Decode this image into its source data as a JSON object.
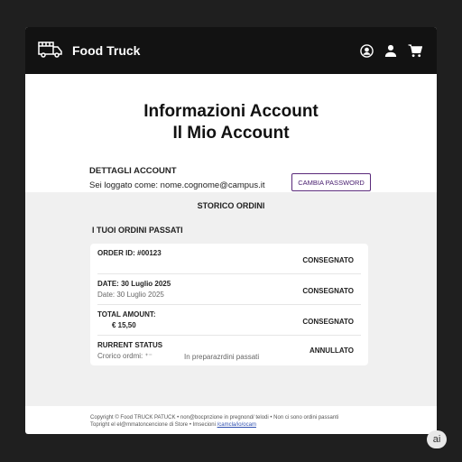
{
  "header": {
    "brand": "Food Truck",
    "icons": [
      "food-truck-icon",
      "account-circle-icon",
      "user-icon",
      "cart-icon"
    ]
  },
  "page": {
    "title1": "Informazioni Account",
    "title2": "Il Mio Account"
  },
  "details": {
    "label": "DETTAGLI ACCOUNT",
    "logged": "Sei loggato come: nome.cognome@campus.it",
    "button": "CAMBIA PASSWORD"
  },
  "history": {
    "title": "STORICO ORDINI",
    "subtitle": "I TUOI ORDINI PASSATI",
    "rows": [
      {
        "l1": "ORDER ID: #00123",
        "l2": "",
        "mid": "",
        "status": "CONSEGNATO"
      },
      {
        "l1": "DATE: 30 Luglio 2025",
        "l2": "Date: 30 Luglio 2025",
        "mid": "",
        "status": "CONSEGNATO"
      },
      {
        "l1": "TOTAL AMOUNT:",
        "l2": "€ 15,50",
        "mid": "",
        "status": "CONSEGNATO"
      },
      {
        "l1": "RURRENT STATUS",
        "l2": "Crorico ordmi: ⁺⁻",
        "mid": "In preparazrdini passati",
        "status": "ANNULLATO"
      }
    ]
  },
  "footer": {
    "line1": "Copyright © Food TRUCK PATUCK  •  non@bocpnzione in pregnond/ telodi  •  Non ci sono ordini passanti",
    "line2": "Topright el el@mmatoncencione di Store  •  Imsecioni ",
    "link": "/camcla/io/ocam"
  },
  "badge": "ai",
  "colors": {
    "header": "#121212",
    "accent": "#5a2a7a",
    "gray": "#f0f0f0"
  }
}
